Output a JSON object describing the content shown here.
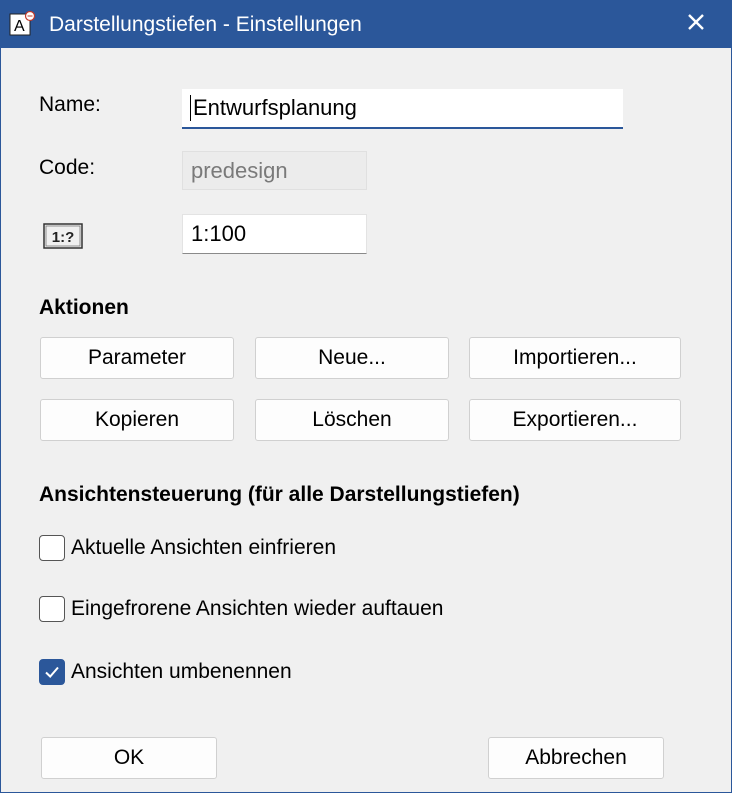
{
  "window": {
    "title": "Darstellungstiefen - Einstellungen",
    "app_icon": "app-a-icon",
    "close_icon": "close-icon",
    "accent_color": "#2b579a"
  },
  "form": {
    "name_label": "Name:",
    "name_value": "Entwurfsplanung",
    "code_label": "Code:",
    "code_value": "predesign",
    "scale_icon_text": "1:?",
    "scale_value": "1:100"
  },
  "actions": {
    "heading": "Aktionen",
    "buttons": [
      "Parameter",
      "Neue...",
      "Importieren...",
      "Kopieren",
      "Löschen",
      "Exportieren..."
    ]
  },
  "views": {
    "heading": "Ansichtensteuerung (für alle Darstellungstiefen)",
    "options": [
      {
        "label": "Aktuelle Ansichten einfrieren",
        "checked": false
      },
      {
        "label": "Eingefrorene Ansichten wieder auftauen",
        "checked": false
      },
      {
        "label": "Ansichten umbenennen",
        "checked": true
      }
    ]
  },
  "footer": {
    "ok_label": "OK",
    "cancel_label": "Abbrechen"
  }
}
